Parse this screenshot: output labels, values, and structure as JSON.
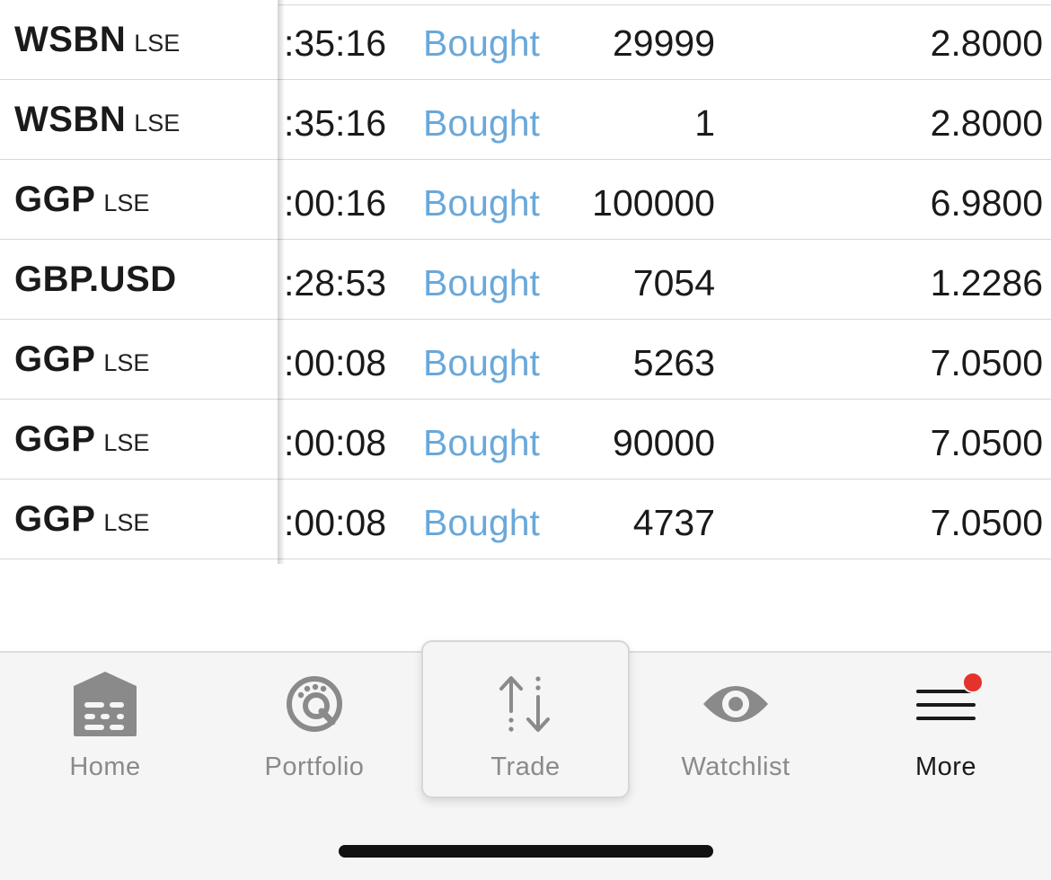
{
  "trades": [
    {
      "symbol": "WSBN",
      "exchange": "LSE",
      "time": ":35:16",
      "action": "Bought",
      "quantity": "29999",
      "price": "2.8000"
    },
    {
      "symbol": "WSBN",
      "exchange": "LSE",
      "time": ":35:16",
      "action": "Bought",
      "quantity": "1",
      "price": "2.8000"
    },
    {
      "symbol": "GGP",
      "exchange": "LSE",
      "time": ":00:16",
      "action": "Bought",
      "quantity": "100000",
      "price": "6.9800"
    },
    {
      "symbol": "GBP.USD",
      "exchange": "",
      "time": ":28:53",
      "action": "Bought",
      "quantity": "7054",
      "price": "1.2286"
    },
    {
      "symbol": "GGP",
      "exchange": "LSE",
      "time": ":00:08",
      "action": "Bought",
      "quantity": "5263",
      "price": "7.0500"
    },
    {
      "symbol": "GGP",
      "exchange": "LSE",
      "time": ":00:08",
      "action": "Bought",
      "quantity": "90000",
      "price": "7.0500"
    },
    {
      "symbol": "GGP",
      "exchange": "LSE",
      "time": ":00:08",
      "action": "Bought",
      "quantity": "4737",
      "price": "7.0500"
    }
  ],
  "tabbar": {
    "tabs": [
      {
        "label": "Home",
        "icon": "home-icon"
      },
      {
        "label": "Portfolio",
        "icon": "portfolio-icon"
      },
      {
        "label": "Trade",
        "icon": "trade-arrows-icon",
        "selected": true
      },
      {
        "label": "Watchlist",
        "icon": "eye-icon"
      },
      {
        "label": "More",
        "icon": "menu-icon",
        "badge": true
      }
    ]
  },
  "colors": {
    "action_blue": "#6aa8d9",
    "badge_red": "#e5322d",
    "icon_gray": "#8a8a8a"
  }
}
